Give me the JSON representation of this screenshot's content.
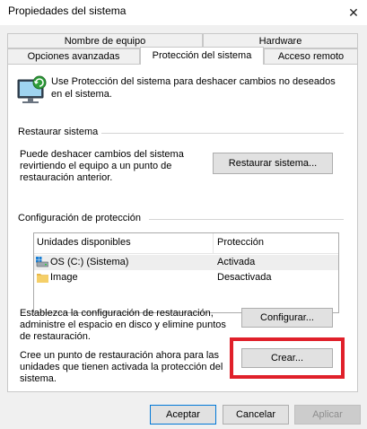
{
  "window": {
    "title": "Propiedades del sistema",
    "close_glyph": "✕"
  },
  "tabs_row1": [
    "Nombre de equipo",
    "Hardware"
  ],
  "tabs_row2": [
    "Opciones avanzadas",
    "Protección del sistema",
    "Acceso remoto"
  ],
  "description": "Use Protección del sistema para deshacer cambios no deseados en el sistema.",
  "restore": {
    "group_title": "Restaurar sistema",
    "text": "Puede deshacer cambios del sistema revirtiendo el equipo a un punto de restauración anterior.",
    "button": "Restaurar sistema..."
  },
  "protection": {
    "group_title": "Configuración de protección",
    "columns": [
      "Unidades disponibles",
      "Protección"
    ],
    "rows": [
      {
        "drive": "OS (C:) (Sistema)",
        "status": "Activada",
        "icon": "system-drive-icon"
      },
      {
        "drive": "Image",
        "status": "Desactivada",
        "icon": "folder-drive-icon"
      }
    ],
    "configure_text": "Establezca la configuración de restauración, administre el espacio en disco y elimine puntos de restauración.",
    "configure_button": "Configurar...",
    "create_text": "Cree un punto de restauración ahora para las unidades que tienen activada la protección del sistema.",
    "create_button": "Crear..."
  },
  "footer": {
    "ok": "Aceptar",
    "cancel": "Cancelar",
    "apply": "Aplicar"
  },
  "colors": {
    "highlight": "#e0202a",
    "primary_border": "#0078d7"
  }
}
